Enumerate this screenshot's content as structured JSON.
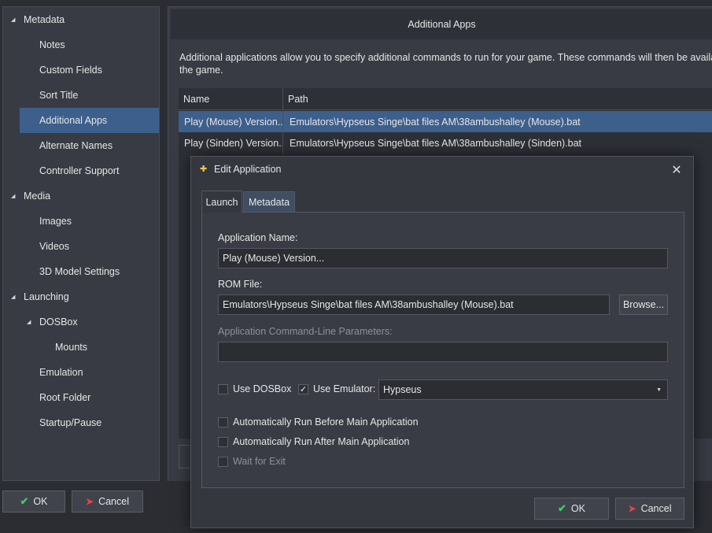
{
  "sidebar": {
    "items": [
      {
        "label": "Metadata",
        "level": 0,
        "expanded": true
      },
      {
        "label": "Notes",
        "level": 1
      },
      {
        "label": "Custom Fields",
        "level": 1
      },
      {
        "label": "Sort Title",
        "level": 1
      },
      {
        "label": "Additional Apps",
        "level": 1,
        "selected": true
      },
      {
        "label": "Alternate Names",
        "level": 1
      },
      {
        "label": "Controller Support",
        "level": 1
      },
      {
        "label": "Media",
        "level": 0,
        "expanded": true
      },
      {
        "label": "Images",
        "level": 1
      },
      {
        "label": "Videos",
        "level": 1
      },
      {
        "label": "3D Model Settings",
        "level": 1
      },
      {
        "label": "Launching",
        "level": 0,
        "expanded": true
      },
      {
        "label": "DOSBox",
        "level": 1,
        "expanded": true
      },
      {
        "label": "Mounts",
        "level": 2
      },
      {
        "label": "Emulation",
        "level": 1
      },
      {
        "label": "Root Folder",
        "level": 1
      },
      {
        "label": "Startup/Pause",
        "level": 1
      }
    ]
  },
  "main": {
    "header": "Additional Apps",
    "description_line1": "Additional applications allow you to specify additional commands to run for your game.  These commands will then be available",
    "description_line2": "the game.",
    "grid": {
      "columns": [
        "Name",
        "Path"
      ],
      "rows": [
        {
          "name": "Play (Mouse) Version...",
          "path": "Emulators\\Hypseus Singe\\bat files AM\\38ambushalley (Mouse).bat"
        },
        {
          "name": "Play (Sinden) Version...",
          "path": "Emulators\\Hypseus Singe\\bat files AM\\38ambushalley (Sinden).bat"
        }
      ]
    }
  },
  "footer": {
    "ok_label": "OK",
    "cancel_label": "Cancel"
  },
  "dialog": {
    "title": "Edit Application",
    "tabs": [
      "Launch",
      "Metadata"
    ],
    "app_name_label": "Application Name:",
    "app_name_value": "Play (Mouse) Version...",
    "rom_file_label": "ROM File:",
    "rom_file_value": "Emulators\\Hypseus Singe\\bat files AM\\38ambushalley (Mouse).bat",
    "browse_label": "Browse...",
    "cmdline_label": "Application Command-Line Parameters:",
    "cmdline_value": "",
    "use_dosbox_label": "Use DOSBox",
    "use_dosbox_checked": false,
    "use_emulator_label": "Use Emulator:",
    "use_emulator_checked": true,
    "emulator_selected": "Hypseus",
    "run_before_label": "Automatically Run Before Main Application",
    "run_after_label": "Automatically Run After Main Application",
    "wait_exit_label": "Wait for Exit",
    "ok_label": "OK",
    "cancel_label": "Cancel"
  },
  "colors": {
    "accent": "#3d5f8c",
    "ok_icon": "#3ecf5a",
    "cancel_icon": "#e04545",
    "app_icon": "#f1c644"
  }
}
